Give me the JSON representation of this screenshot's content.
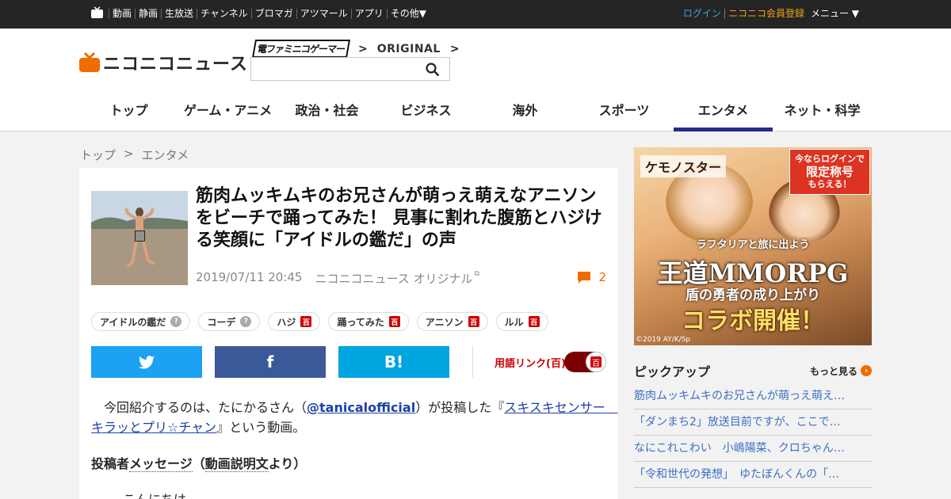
{
  "topbar": {
    "nav": [
      "動画",
      "静画",
      "生放送",
      "チャンネル",
      "ブロマガ",
      "アツマール",
      "アプリ",
      "その他▼"
    ],
    "login": "ログイン",
    "register": "ニコニコ会員登録",
    "menu": "メニュー ▼"
  },
  "header": {
    "logo_text": "ニコニコニュース",
    "dengeki": "電ファミニコゲーマー",
    "original": "ORIGINAL",
    "search_placeholder": "",
    "nav": [
      "トップ",
      "ゲーム・アニメ",
      "政治・社会",
      "ビジネス",
      "海外",
      "スポーツ",
      "エンタメ",
      "ネット・科学"
    ],
    "active_nav": "エンタメ"
  },
  "breadcrumb": {
    "home": "トップ",
    "sep": ">",
    "current": "エンタメ"
  },
  "article": {
    "title": "筋肉ムッキムキのお兄さんが萌っえ萌えなアニソンをビーチで踊ってみた！ 見事に割れた腹筋とハジける笑顔に「アイドルの鑑だ」の声",
    "date": "2019/07/11 20:45",
    "source": "ニコニコニュース オリジナル",
    "comment_count": "2",
    "tags": [
      {
        "label": "アイドルの鑑だ",
        "icon": "?"
      },
      {
        "label": "コーデ",
        "icon": "?"
      },
      {
        "label": "ハジ",
        "icon": "百"
      },
      {
        "label": "踊ってみた",
        "icon": "百"
      },
      {
        "label": "アニソン",
        "icon": "百"
      },
      {
        "label": "ルル",
        "icon": "百"
      }
    ],
    "share": {
      "twitter": "",
      "facebook": "f",
      "hatena": "B!"
    },
    "yougo_label": "用語リンク(",
    "yougo_icon": "百",
    "yougo_close": ")",
    "toggle_icon": "百",
    "body_1": "　今回紹介するのは、たにかるさん（",
    "body_link_user": "@tanicalofficial",
    "body_2": "）が投稿した『",
    "body_link_video": "スキスキセンサー　キラッとプリ☆チャン",
    "body_3": "』という動画。",
    "poster_label": "投稿者",
    "poster_message": "メッセージ",
    "poster_paren_open": "（",
    "poster_desc": "動画説明文",
    "poster_paren_close": "より）",
    "hello": "こんにちは"
  },
  "sidebar": {
    "ad": {
      "game_name": "ケモノスター",
      "login_line1": "今ならログインで",
      "login_line2": "限定称号",
      "login_line3": "もらえる！",
      "sub": "ラフタリアと旅に出よう",
      "mmo": "王道MMORPG",
      "shield": "盾の勇者の成り上がり",
      "collab": "コラボ開催！",
      "copyright": "©2019 AY/K/Sp"
    },
    "pickup_title": "ピックアップ",
    "more": "もっと見る",
    "pickup": [
      "筋肉ムッキムキのお兄さんが萌っえ萌え…",
      "「ダンまち2」放送目前ですが、ここで…",
      "なにこれこわい　小嶋陽菜、クロちゃん…",
      "「令和世代の発想」　ゆたぼんくんの「…"
    ]
  },
  "colors": {
    "topbar": "#252525",
    "accent_nav": "#252d8a",
    "twitter": "#1da1f2",
    "facebook": "#3b5998",
    "hatena": "#00a4de",
    "comment": "#ef6c00",
    "link": "#1e40a6"
  }
}
